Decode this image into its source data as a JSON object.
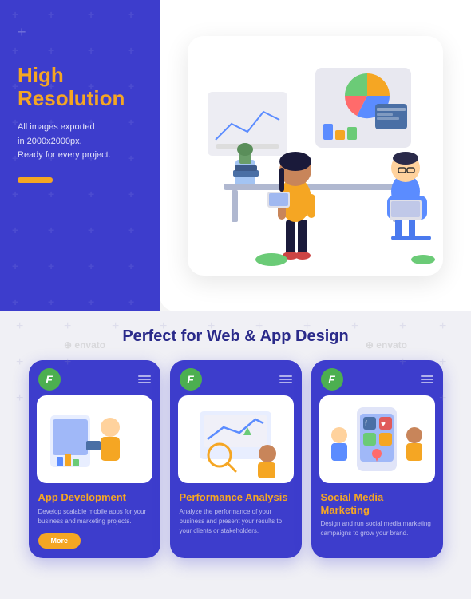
{
  "hero": {
    "title_line1": "High",
    "title_line2": "Resolution",
    "subtitle_line1": "All images exported",
    "subtitle_line2": "in 2000x2000px.",
    "subtitle_line3": "Ready for every project."
  },
  "bottom": {
    "section_title": "Perfect for Web & App Design",
    "cards": [
      {
        "logo": "F",
        "title": "App Development",
        "description": "Develop scalable mobile apps for your business and marketing projects.",
        "has_button": true,
        "button_label": "More"
      },
      {
        "logo": "F",
        "title": "Performance Analysis",
        "description": "Analyze the performance of your business and present your results to your clients or stakeholders.",
        "has_button": false,
        "button_label": ""
      },
      {
        "logo": "F",
        "title": "Social Media Marketing",
        "description": "Design and run social media marketing campaigns to grow your brand.",
        "has_button": false,
        "button_label": ""
      }
    ]
  },
  "watermarks": {
    "envato1": "⊕ envato",
    "envato2": "⊕ envato"
  }
}
